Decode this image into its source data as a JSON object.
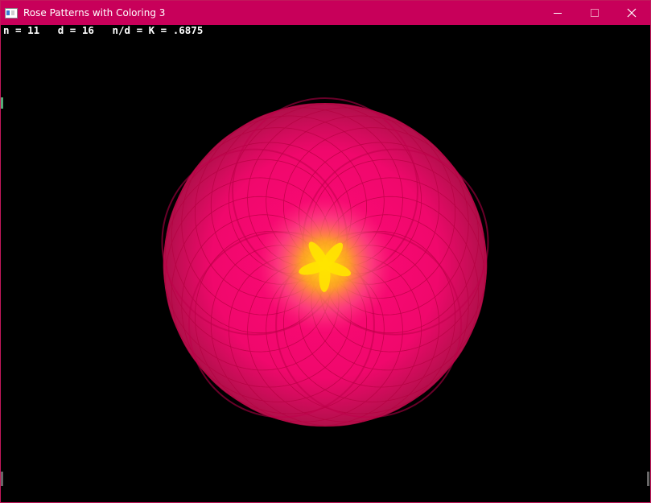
{
  "window": {
    "title": "Rose Patterns with Coloring 3",
    "icons": {
      "app": "app-window-icon",
      "minimize": "minimize-icon",
      "maximize": "maximize-icon",
      "close": "close-icon"
    },
    "colors": {
      "titlebar": "#c8005a",
      "background": "#000000"
    }
  },
  "readout": {
    "text": "n = 11   d = 16   n/d = K = .6875"
  },
  "rose": {
    "n": 11,
    "d": 16,
    "k": 0.6875,
    "colors": {
      "outer": "#b0104a",
      "fill": "#ff0a78",
      "glow": "#ff6f8a",
      "center": "#ffe400",
      "stroke": "#b3003f"
    }
  }
}
